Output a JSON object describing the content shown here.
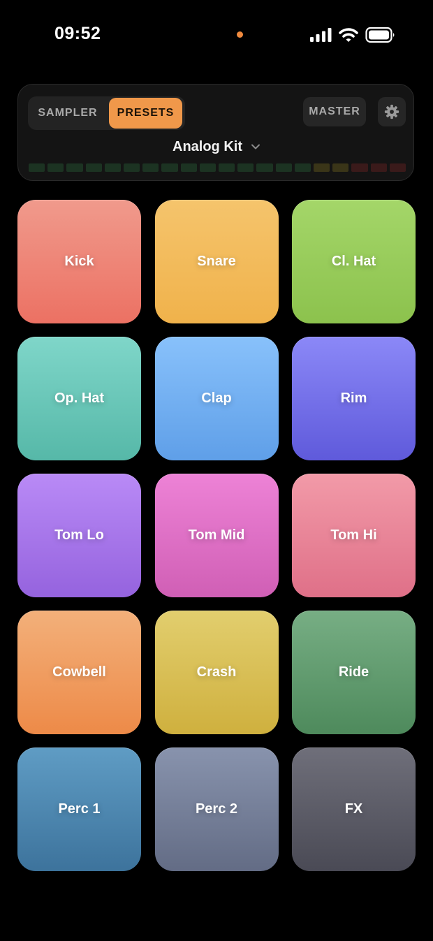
{
  "status_bar": {
    "time": "09:52"
  },
  "header": {
    "tabs": [
      {
        "label": "SAMPLER",
        "active": false
      },
      {
        "label": "PRESETS",
        "active": true
      }
    ],
    "master_label": "MASTER",
    "settings_icon": "gear-icon",
    "kit_name": "Analog Kit",
    "kit_chevron_icon": "chevron-down-icon",
    "meter": {
      "segments": 20,
      "level": 0,
      "colors": {
        "green": "#1c3322",
        "yellow": "#3a3518",
        "red": "#3a1a1a"
      }
    }
  },
  "colors": {
    "accent": "#f0984a",
    "background": "#000000"
  },
  "pads": [
    {
      "label": "Kick",
      "top": "#f09a8c",
      "bottom": "#ec7163"
    },
    {
      "label": "Snare",
      "top": "#f5c46c",
      "bottom": "#f0b24b"
    },
    {
      "label": "Cl. Hat",
      "top": "#a4d669",
      "bottom": "#8cc24d"
    },
    {
      "label": "Op. Hat",
      "top": "#7fd6c9",
      "bottom": "#56b8a8"
    },
    {
      "label": "Clap",
      "top": "#88c1fb",
      "bottom": "#5f9fe8"
    },
    {
      "label": "Rim",
      "top": "#8b88f7",
      "bottom": "#5f5adb"
    },
    {
      "label": "Tom Lo",
      "top": "#b98af6",
      "bottom": "#9563de"
    },
    {
      "label": "Tom Mid",
      "top": "#ed82d6",
      "bottom": "#d05fb5"
    },
    {
      "label": "Tom Hi",
      "top": "#f29aa8",
      "bottom": "#df7088"
    },
    {
      "label": "Cowbell",
      "top": "#f3b07a",
      "bottom": "#ed8a48"
    },
    {
      "label": "Crash",
      "top": "#e2ce6e",
      "bottom": "#cfb03e"
    },
    {
      "label": "Ride",
      "top": "#77ae84",
      "bottom": "#4e8a5c"
    },
    {
      "label": "Perc 1",
      "top": "#5f9cc4",
      "bottom": "#3d739c"
    },
    {
      "label": "Perc 2",
      "top": "#8893ad",
      "bottom": "#636c85"
    },
    {
      "label": "FX",
      "top": "#6f6f7a",
      "bottom": "#4a4a55"
    }
  ]
}
